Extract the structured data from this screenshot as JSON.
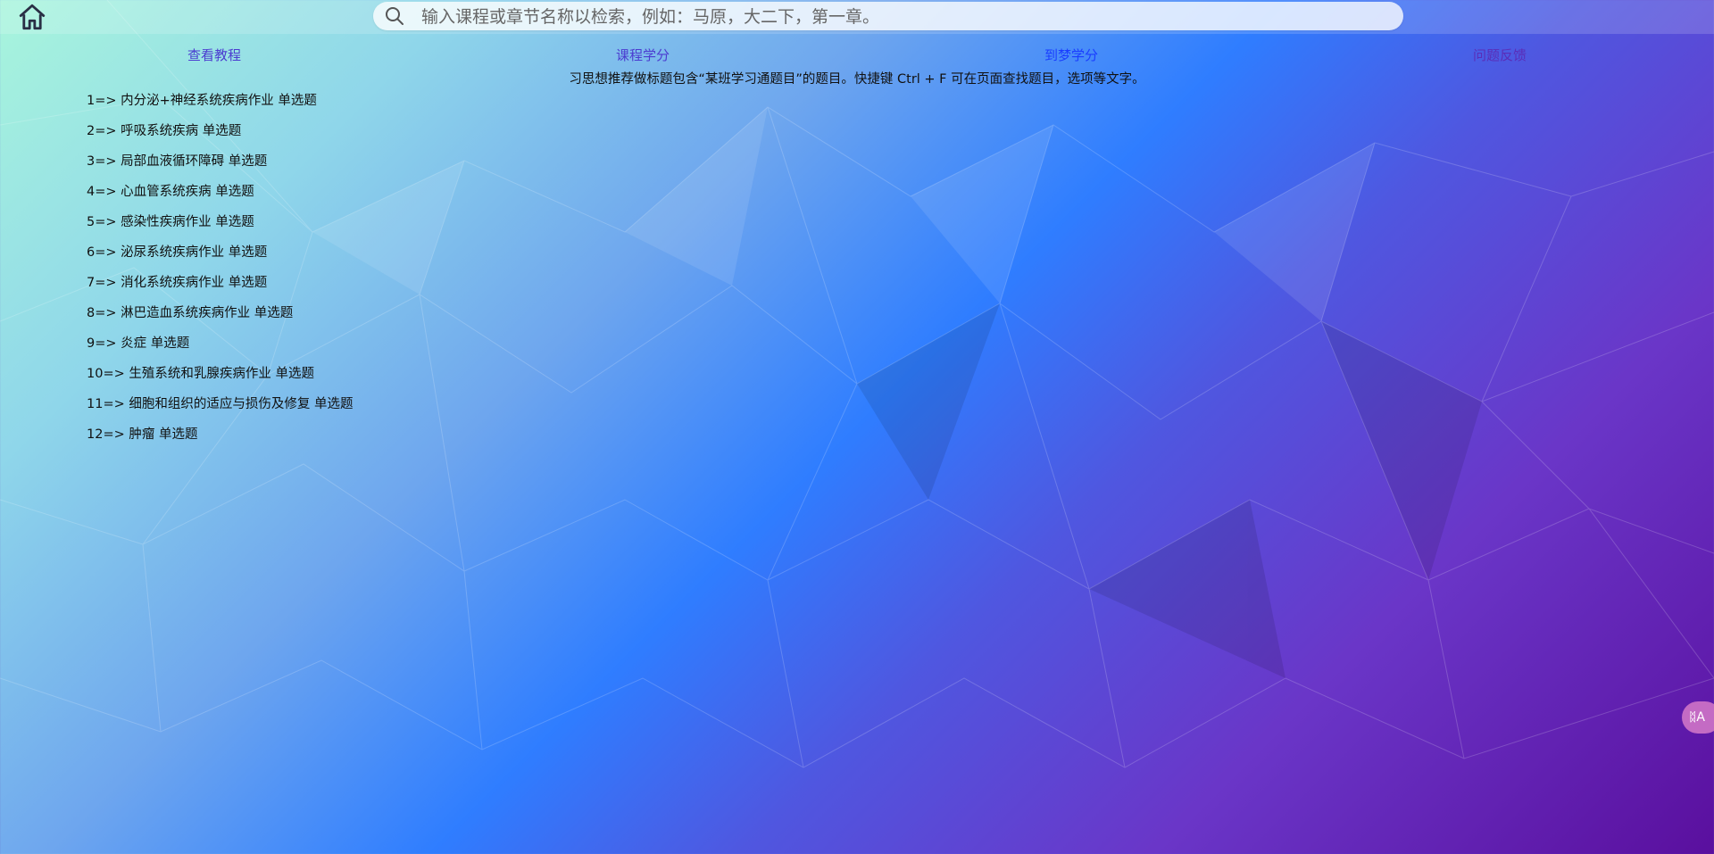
{
  "header": {
    "home_icon": "home-icon",
    "search": {
      "icon": "search-icon",
      "placeholder": "输入课程或章节名称以检索，例如：马原，大二下，第一章。",
      "value": ""
    }
  },
  "nav": {
    "links": [
      {
        "label": "查看教程"
      },
      {
        "label": "课程学分"
      },
      {
        "label": "到梦学分"
      },
      {
        "label": "问题反馈"
      }
    ]
  },
  "notice": "习思想推荐做标题包含“某班学习通题目”的题目。快捷键 Ctrl + F 可在页面查找题目，选项等文字。",
  "items": [
    {
      "index": "1=>",
      "title": "内分泌+神经系统疾病作业",
      "type": "单选题"
    },
    {
      "index": "2=>",
      "title": "呼吸系统疾病",
      "type": "单选题"
    },
    {
      "index": "3=>",
      "title": "局部血液循环障碍",
      "type": "单选题"
    },
    {
      "index": "4=>",
      "title": "心血管系统疾病",
      "type": "单选题"
    },
    {
      "index": "5=>",
      "title": "感染性疾病作业",
      "type": "单选题"
    },
    {
      "index": "6=>",
      "title": "泌尿系统疾病作业",
      "type": "单选题"
    },
    {
      "index": "7=>",
      "title": "消化系统疾病作业",
      "type": "单选题"
    },
    {
      "index": "8=>",
      "title": "淋巴造血系统疾病作业",
      "type": "单选题"
    },
    {
      "index": "9=>",
      "title": "炎症",
      "type": "单选题"
    },
    {
      "index": "10=>",
      "title": "生殖系统和乳腺疾病作业",
      "type": "单选题"
    },
    {
      "index": "11=>",
      "title": "细胞和组织的适应与损伤及修复",
      "type": "单选题"
    },
    {
      "index": "12=>",
      "title": "肿瘤",
      "type": "单选题"
    }
  ],
  "floating": {
    "translate_icon": "translate-icon",
    "label": "ᛥA"
  },
  "colors": {
    "accent": "#1a3dff",
    "nav_purple": "#4b3cd0"
  }
}
